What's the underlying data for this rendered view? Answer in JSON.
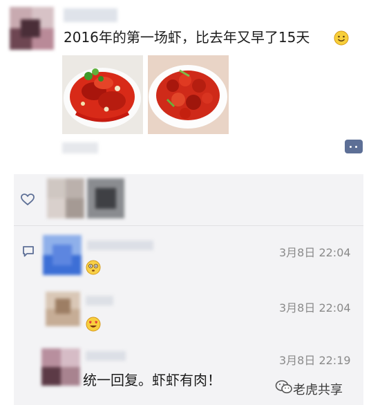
{
  "post": {
    "text": "2016年的第一场虾，比去年又早了15天",
    "icons": [
      "smile-emoji",
      "comment-more-icon"
    ]
  },
  "likes": {
    "icon": "heart-icon"
  },
  "comments_icon": "comment-bubble-icon",
  "comments": [
    {
      "timestamp": "3月8日 22:04",
      "emoji": "flushed-face-emoji"
    },
    {
      "timestamp": "3月8日 22:04",
      "emoji": "heart-eyes-emoji"
    },
    {
      "timestamp": "3月8日 22:19",
      "text": "统一回复。虾虾有肉！"
    }
  ],
  "watermark": {
    "text": "老虎共享",
    "icon": "wechat-logo-icon"
  }
}
